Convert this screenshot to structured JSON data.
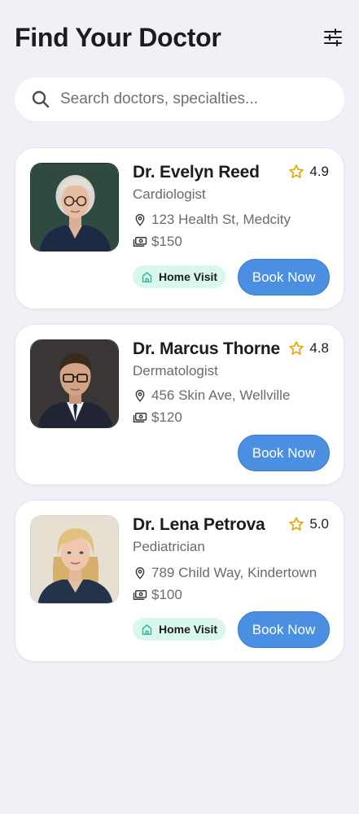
{
  "header": {
    "title": "Find Your Doctor",
    "filter_icon": "sliders-icon"
  },
  "search": {
    "placeholder": "Search doctors, specialties...",
    "value": "",
    "icon": "search-icon"
  },
  "colors": {
    "accent": "#4a8fe2",
    "badge_bg": "#d9f6ef",
    "badge_icon": "#2fbf94",
    "star": "#f0a500",
    "background": "#f1f0f6"
  },
  "doctors": [
    {
      "name": "Dr. Evelyn Reed",
      "rating": "4.9",
      "specialty": "Cardiologist",
      "address": "123 Health St, Medcity",
      "price": "$150",
      "home_visit": true,
      "home_visit_label": "Home Visit",
      "book_label": "Book Now"
    },
    {
      "name": "Dr. Marcus Thorne",
      "rating": "4.8",
      "specialty": "Dermatologist",
      "address": "456 Skin Ave, Wellville",
      "price": "$120",
      "home_visit": false,
      "book_label": "Book Now"
    },
    {
      "name": "Dr. Lena Petrova",
      "rating": "5.0",
      "specialty": "Pediatrician",
      "address": "789 Child Way, Kindertown",
      "price": "$100",
      "home_visit": true,
      "home_visit_label": "Home Visit",
      "book_label": "Book Now"
    }
  ]
}
